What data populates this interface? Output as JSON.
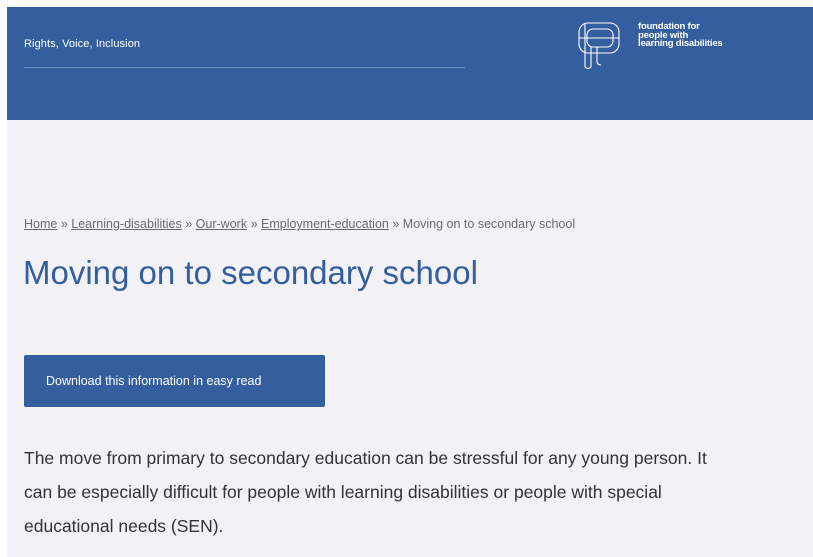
{
  "header": {
    "tagline": "Rights, Voice, Inclusion",
    "logo": {
      "line1": "foundation for",
      "line2": "people with",
      "line3": "learning disabilities"
    }
  },
  "breadcrumb": {
    "items": [
      "Home",
      "Learning-disabilities",
      "Our-work",
      "Employment-education"
    ],
    "separator": "»",
    "current": "Moving on to secondary school"
  },
  "page": {
    "title": "Moving on to secondary school",
    "download_label": "Download this information in easy read",
    "intro_lines": [
      "The move from primary to secondary education can be stressful for any young person. It",
      "can be especially difficult for people with learning disabilities or people with special",
      "educational needs (SEN)."
    ]
  },
  "colors": {
    "brand_blue": "#345e9d",
    "page_background": "#f2f1f6",
    "text": "#333333",
    "breadcrumb": "#6b6b6b"
  }
}
